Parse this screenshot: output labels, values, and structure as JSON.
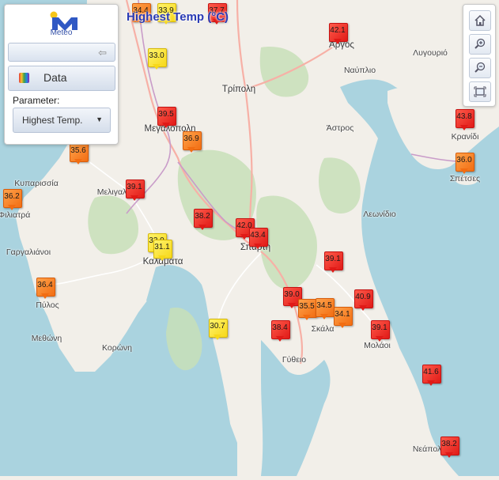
{
  "app": {
    "logo_text": "Meteo"
  },
  "map_title": "Highest Temp (°C)",
  "panel": {
    "data_label": "Data",
    "parameter_label": "Parameter:",
    "parameter_value": "Highest Temp."
  },
  "toolbar": [
    "home-icon",
    "zoom-in-icon",
    "zoom-out-icon",
    "zoom-extent-icon"
  ],
  "colors": {
    "title": "#2a3bb5",
    "hot": "#e8231e",
    "orange": "#f57a18",
    "yellow": "#fde82c",
    "sea": "#aad3df"
  },
  "places": [
    "Άργος",
    "Λυγουριό",
    "Ναύπλιο",
    "Τρίπολη",
    "Μεγαλόπολη",
    "Άστρος",
    "Κρανίδι",
    "Σπέτσες",
    "Κυπαρισσία",
    "Μελιγαλάς",
    "Φιλιατρά",
    "Λεωνίδιο",
    "Γαργαλιάνοι",
    "Καλαμάτα",
    "Σπάρτη",
    "Πύλος",
    "Μεθώνη",
    "Κορώνη",
    "Σκάλα",
    "Μολάοι",
    "Γύθειο",
    "Νεάπολη"
  ],
  "stations": [
    {
      "value": "34.4",
      "color": "orange"
    },
    {
      "value": "33.9",
      "color": "yellow"
    },
    {
      "value": "37.7",
      "color": "hot"
    },
    {
      "value": "42.1",
      "color": "hot"
    },
    {
      "value": "33.0",
      "color": "yellow"
    },
    {
      "value": "39.5",
      "color": "hot"
    },
    {
      "value": "36.9",
      "color": "orange"
    },
    {
      "value": "43.8",
      "color": "hot"
    },
    {
      "value": "36.0",
      "color": "orange"
    },
    {
      "value": "35.6",
      "color": "orange"
    },
    {
      "value": "39.1",
      "color": "hot"
    },
    {
      "value": "36.2",
      "color": "orange"
    },
    {
      "value": "38.2",
      "color": "hot"
    },
    {
      "value": "42.0",
      "color": "hot"
    },
    {
      "value": "43.4",
      "color": "hot"
    },
    {
      "value": "33.0",
      "color": "yellow"
    },
    {
      "value": "31.1",
      "color": "yellow"
    },
    {
      "value": "36.4",
      "color": "orange"
    },
    {
      "value": "39.1",
      "color": "hot"
    },
    {
      "value": "39.0",
      "color": "hot"
    },
    {
      "value": "35.5",
      "color": "orange"
    },
    {
      "value": "34.5",
      "color": "orange"
    },
    {
      "value": "34.1",
      "color": "orange"
    },
    {
      "value": "40.9",
      "color": "hot"
    },
    {
      "value": "30.7",
      "color": "yellow"
    },
    {
      "value": "38.4",
      "color": "hot"
    },
    {
      "value": "39.1",
      "color": "hot"
    },
    {
      "value": "41.6",
      "color": "hot"
    },
    {
      "value": "38.2",
      "color": "hot"
    }
  ]
}
